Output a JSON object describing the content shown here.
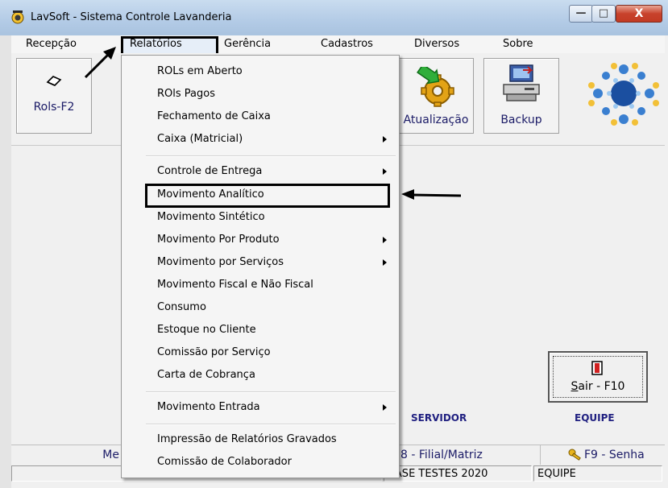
{
  "window": {
    "title": "LavSoft - Sistema Controle Lavanderia"
  },
  "window_controls": {
    "minimize": "—",
    "maximize": "□",
    "close": "X"
  },
  "menubar": {
    "items": [
      "Recepção",
      "Relatórios",
      "Gerência",
      "Cadastros",
      "Diversos",
      "Sobre"
    ],
    "active": "Relatórios"
  },
  "toolbar": {
    "rols": "Rols-F2",
    "atualizacao": "Atualização",
    "backup": "Backup"
  },
  "dropdown": {
    "items": [
      {
        "label": "ROLs em Aberto",
        "submenu": false
      },
      {
        "label": "ROls Pagos",
        "submenu": false
      },
      {
        "label": "Fechamento de Caixa",
        "submenu": false
      },
      {
        "label": "Caixa (Matricial)",
        "submenu": true
      },
      {
        "label": "Controle de Entrega",
        "submenu": true
      },
      {
        "label": "Movimento Analítico",
        "submenu": false
      },
      {
        "label": "Movimento Sintético",
        "submenu": false
      },
      {
        "label": "Movimento Por Produto",
        "submenu": true
      },
      {
        "label": "Movimento por Serviços",
        "submenu": true
      },
      {
        "label": "Movimento Fiscal e Não Fiscal",
        "submenu": false
      },
      {
        "label": "Consumo",
        "submenu": false
      },
      {
        "label": "Estoque no Cliente",
        "submenu": false
      },
      {
        "label": "Comissão por Serviço",
        "submenu": false
      },
      {
        "label": "Carta de Cobrança",
        "submenu": false
      },
      {
        "label": "Movimento Entrada",
        "submenu": true
      },
      {
        "label": "Impressão de Relatórios Gravados",
        "submenu": false
      },
      {
        "label": "Comissão de Colaborador",
        "submenu": false
      }
    ]
  },
  "main": {
    "servidor": "SERVIDOR",
    "equipe": "EQUIPE",
    "sair_key": "S",
    "sair_rest": "air - F10"
  },
  "fkeys": {
    "left_partial": "Me",
    "filial": "8 - Filial/Matriz",
    "senha": "F9 - Senha"
  },
  "status": {
    "base": "BASE TESTES 2020",
    "equipe": "EQUIPE"
  }
}
